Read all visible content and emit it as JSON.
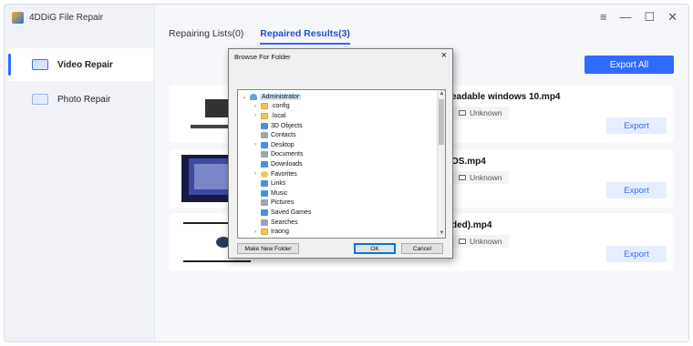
{
  "app": {
    "title": "4DDiG File Repair",
    "window_controls": {
      "menu": "≡",
      "minimize": "—",
      "maximize": "☐",
      "close": "✕"
    }
  },
  "sidebar": {
    "items": [
      {
        "label": "Video Repair",
        "icon": "video-icon",
        "active": true
      },
      {
        "label": "Photo Repair",
        "icon": "photo-icon",
        "active": false
      }
    ]
  },
  "tabs": [
    {
      "label": "Repairing Lists(0)",
      "active": false
    },
    {
      "label": "Repaired Results(3)",
      "active": true
    }
  ],
  "toolbar": {
    "export_all": "Export All"
  },
  "results": [
    {
      "name_visible": "eadable windows 10.mp4",
      "meta": "Unknown",
      "export": "Export"
    },
    {
      "name_visible": "OS.mp4",
      "meta": "Unknown",
      "export": "Export"
    },
    {
      "name_visible": "ded).mp4",
      "meta": "Unknown",
      "export": "Export"
    }
  ],
  "dialog": {
    "title": "Browse For Folder",
    "close": "×",
    "tree": [
      {
        "label": "Administrator",
        "icon": "user",
        "chevron": "⌄",
        "selected": true
      },
      {
        "label": ".config",
        "icon": "fold",
        "chevron": "›"
      },
      {
        "label": ".local",
        "icon": "fold",
        "chevron": "›"
      },
      {
        "label": "3D Objects",
        "icon": "blue",
        "chevron": ""
      },
      {
        "label": "Contacts",
        "icon": "grey",
        "chevron": ""
      },
      {
        "label": "Desktop",
        "icon": "blue",
        "chevron": "›"
      },
      {
        "label": "Documents",
        "icon": "grey",
        "chevron": ""
      },
      {
        "label": "Downloads",
        "icon": "blue",
        "chevron": ""
      },
      {
        "label": "Favorites",
        "icon": "star",
        "chevron": "›"
      },
      {
        "label": "Links",
        "icon": "blue",
        "chevron": ""
      },
      {
        "label": "Music",
        "icon": "blue",
        "chevron": ""
      },
      {
        "label": "Pictures",
        "icon": "grey",
        "chevron": ""
      },
      {
        "label": "Saved Games",
        "icon": "blue",
        "chevron": ""
      },
      {
        "label": "Searches",
        "icon": "grey",
        "chevron": ""
      },
      {
        "label": "Iraong",
        "icon": "fold",
        "chevron": "›"
      }
    ],
    "buttons": {
      "new_folder": "Make New Folder",
      "ok": "OK",
      "cancel": "Cancel"
    }
  },
  "colors": {
    "accent": "#2f6bff",
    "selection": "#cce4f7"
  }
}
